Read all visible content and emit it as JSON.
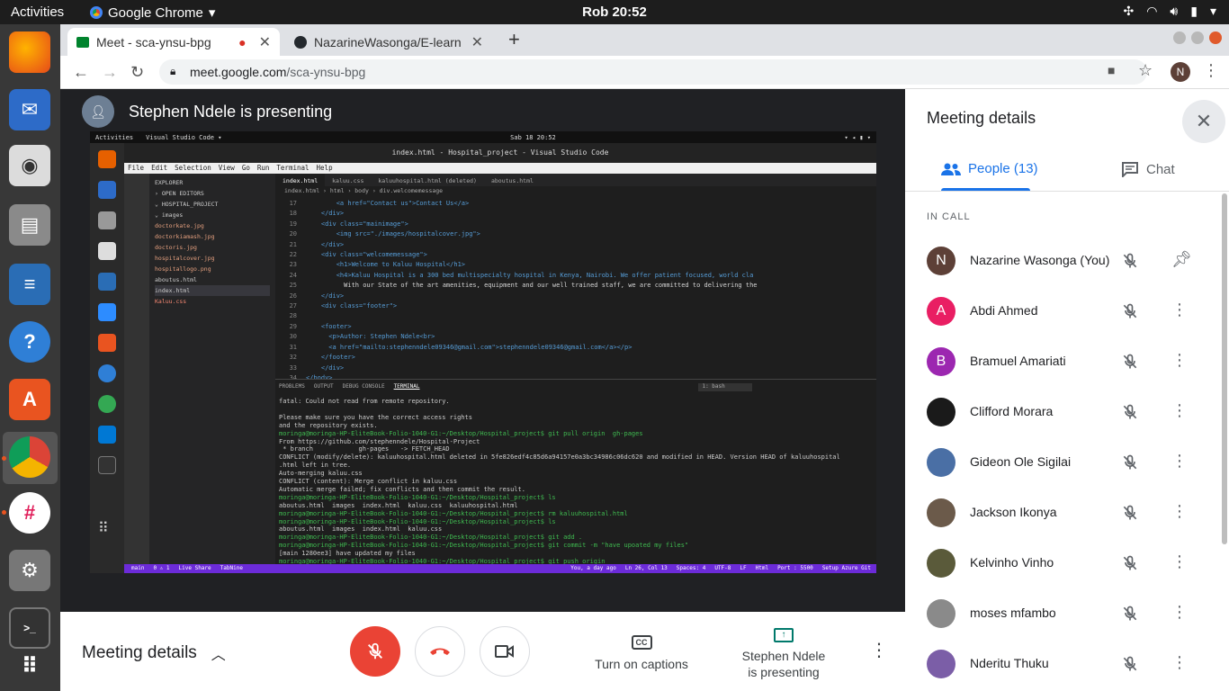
{
  "system": {
    "activities": "Activities",
    "app_name": "Google Chrome",
    "clock": "Rob 20:52"
  },
  "browser": {
    "tabs": [
      {
        "title": "Meet - sca-ynsu-bpg"
      },
      {
        "title": "NazarineWasonga/E-learn"
      }
    ],
    "url_host": "meet.google.com",
    "url_path": "/sca-ynsu-bpg",
    "profile_initial": "N"
  },
  "stage": {
    "presenter_text": "Stephen Ndele is presenting",
    "shared_screen": {
      "top_left": "Activities",
      "top_app": "Visual Studio Code ▾",
      "top_clock": "Sab 18  20:52",
      "window_title": "index.html - Hospital_project - Visual Studio Code",
      "menu": [
        "File",
        "Edit",
        "Selection",
        "View",
        "Go",
        "Run",
        "Terminal",
        "Help"
      ],
      "explorer": [
        "EXPLORER",
        "› OPEN EDITORS",
        "⌄ HOSPITAL_PROJECT",
        "  ⌄ images",
        "     doctorkate.jpg",
        "     doctorkiamash.jpg",
        "     doctoris.jpg",
        "     hospitalcover.jpg",
        "     hospitallogo.png",
        "   aboutus.html",
        "   index.html",
        "   Kaluu.css"
      ],
      "editor_tabs": [
        "index.html",
        "kaluu.css",
        "kaluuhospital.html (deleted)",
        "aboutus.html"
      ],
      "breadcrumb": "index.html › html › body › div.welcomemessage",
      "code": [
        {
          "n": "17",
          "t": "        <a href=\"Contact us\">Contact Us</a>"
        },
        {
          "n": "18",
          "t": "    </div>"
        },
        {
          "n": "19",
          "t": "    <div class=\"mainimage\">"
        },
        {
          "n": "20",
          "t": "        <img src=\"./images/hospitalcover.jpg\">"
        },
        {
          "n": "21",
          "t": "    </div>"
        },
        {
          "n": "22",
          "t": "    <div class=\"welcomemessage\">"
        },
        {
          "n": "23",
          "t": "        <h1>Welcome to Kaluu Hospital</h1>"
        },
        {
          "n": "24",
          "t": "        <h4>Kaluu Hospital is a 300 bed multispecialty hospital in Kenya, Nairobi. We offer patient focused, world cla"
        },
        {
          "n": "25",
          "t": "          With our State of the art amenities, equipment and our well trained staff, we are committed to delivering the"
        },
        {
          "n": "26",
          "t": "    </div>"
        },
        {
          "n": "27",
          "t": "    <div class=\"footer\">"
        },
        {
          "n": "28",
          "t": ""
        },
        {
          "n": "29",
          "t": "    <footer>"
        },
        {
          "n": "30",
          "t": "      <p>Author: Stephen Ndele<br>"
        },
        {
          "n": "31",
          "t": "      <a href=\"mailto:stephenndele09346@gmail.com\">stephenndele09346@gmail.com</a></p>"
        },
        {
          "n": "32",
          "t": "    </footer>"
        },
        {
          "n": "33",
          "t": "    </div>"
        },
        {
          "n": "34",
          "t": "</body>"
        },
        {
          "n": "35",
          "t": "</html>"
        }
      ],
      "terminal_tabs": [
        "PROBLEMS",
        "OUTPUT",
        "DEBUG CONSOLE",
        "TERMINAL"
      ],
      "terminal_shell": "1: bash",
      "terminal": [
        "fatal: Could not read from remote repository.",
        "",
        "Please make sure you have the correct access rights",
        "and the repository exists.",
        "moringa@moringa-HP-EliteBook-Folio-1040-G1:~/Desktop/Hospital_project$ git pull origin  gh-pages",
        "From https://github.com/stephenndele/Hospital-Project",
        " * branch            gh-pages   -> FETCH_HEAD",
        "CONFLICT (modify/delete): kaluuhospital.html deleted in 5fe826edf4c85d6a94157e0a3bc34986c06dc620 and modified in HEAD. Version HEAD of kaluuhospital",
        ".html left in tree.",
        "Auto-merging kaluu.css",
        "CONFLICT (content): Merge conflict in kaluu.css",
        "Automatic merge failed; fix conflicts and then commit the result.",
        "moringa@moringa-HP-EliteBook-Folio-1040-G1:~/Desktop/Hospital_project$ ls",
        "aboutus.html  images  index.html  kaluu.css  kaluuhospital.html",
        "moringa@moringa-HP-EliteBook-Folio-1040-G1:~/Desktop/Hospital_project$ rm kaluuhospital.html",
        "moringa@moringa-HP-EliteBook-Folio-1040-G1:~/Desktop/Hospital_project$ ls",
        "aboutus.html  images  index.html  kaluu.css",
        "moringa@moringa-HP-EliteBook-Folio-1040-G1:~/Desktop/Hospital_project$ git add .",
        "moringa@moringa-HP-EliteBook-Folio-1040-G1:~/Desktop/Hospital_project$ git commit -m \"have upoated my files\"",
        "[main 1280ee3] have updated my files",
        "moringa@moringa-HP-EliteBook-Folio-1040-G1:~/Desktop/Hospital_project$ git push origin "
      ],
      "status_left": [
        "main",
        "0 ⚠ 1",
        "Live Share",
        "TabNine"
      ],
      "status_right": [
        "You, a day ago",
        "Ln 26, Col 13",
        "Spaces: 4",
        "UTF-8",
        "LF",
        "Html",
        "Port : 5500",
        "Setup Azure Git"
      ]
    }
  },
  "controls": {
    "meeting_details": "Meeting details",
    "captions_label": "Turn on captions",
    "captions_icon": "CC",
    "presenting_line1": "Stephen Ndele",
    "presenting_line2": "is presenting"
  },
  "panel": {
    "title": "Meeting details",
    "tab_people": "People (13)",
    "tab_chat": "Chat",
    "section": "IN CALL",
    "people": [
      {
        "name": "Nazarine Wasonga (You)",
        "initial": "N",
        "color": "#5d4037"
      },
      {
        "name": "Abdi Ahmed",
        "initial": "A",
        "color": "#e91e63"
      },
      {
        "name": "Bramuel Amariati",
        "initial": "B",
        "color": "#9c27b0"
      },
      {
        "name": "Clifford Morara",
        "initial": "",
        "color": "#1a1a1a"
      },
      {
        "name": "Gideon Ole Sigilai",
        "initial": "",
        "color": "#4a6fa5"
      },
      {
        "name": "Jackson Ikonya",
        "initial": "",
        "color": "#6b5a4a"
      },
      {
        "name": "Kelvinho Vinho",
        "initial": "",
        "color": "#5a5a3a"
      },
      {
        "name": "moses mfambo",
        "initial": "",
        "color": "#8a8a8a"
      },
      {
        "name": "Nderitu Thuku",
        "initial": "",
        "color": "#7b5ea7"
      }
    ]
  },
  "colors": {
    "accent": "#1a73e8",
    "hangup": "#ea4335",
    "brand_green": "#00796b"
  }
}
